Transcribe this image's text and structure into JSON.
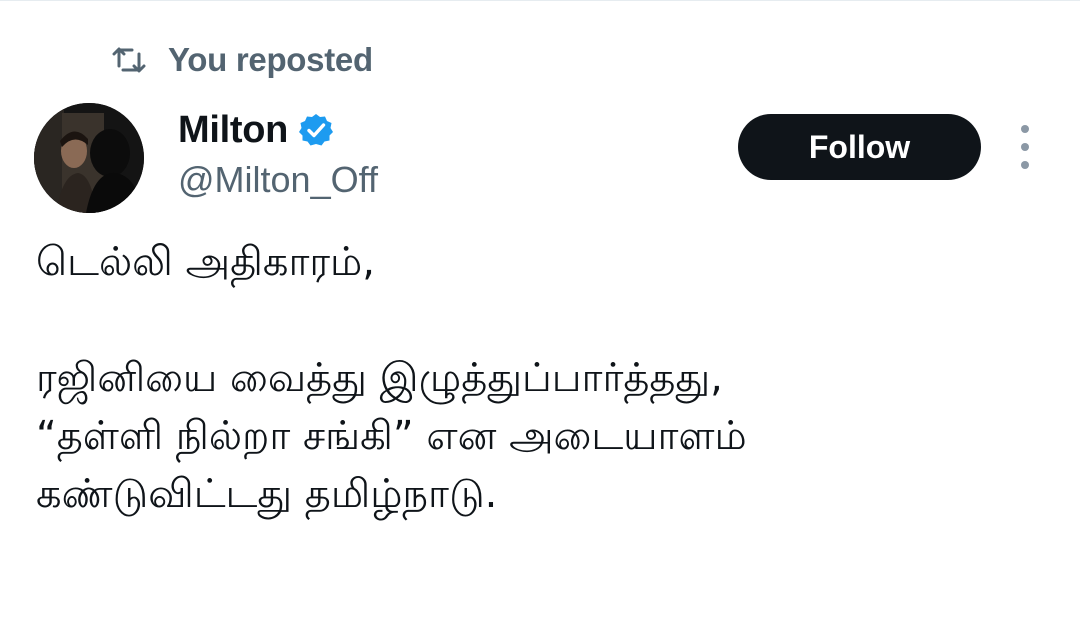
{
  "repost": {
    "icon": "repost-icon",
    "label": "You reposted"
  },
  "author": {
    "display_name": "Milton",
    "handle": "@Milton_Off",
    "verified": true,
    "verified_color": "#1d9bf0",
    "avatar": "avatar-photo"
  },
  "actions": {
    "follow_label": "Follow",
    "more_icon": "more-vertical-icon"
  },
  "tweet": {
    "lines": [
      "டெல்லி அதிகாரம்,",
      "",
      "ரஜினியை வைத்து இழுத்துப்பார்த்தது,",
      "“தள்ளி நில்றா சங்கி” என அடையாளம்",
      "கண்டுவிட்டது தமிழ்நாடு."
    ]
  },
  "colors": {
    "text_primary": "#0f1419",
    "text_secondary": "#536471",
    "button_bg": "#0f1419",
    "button_text": "#ffffff"
  }
}
